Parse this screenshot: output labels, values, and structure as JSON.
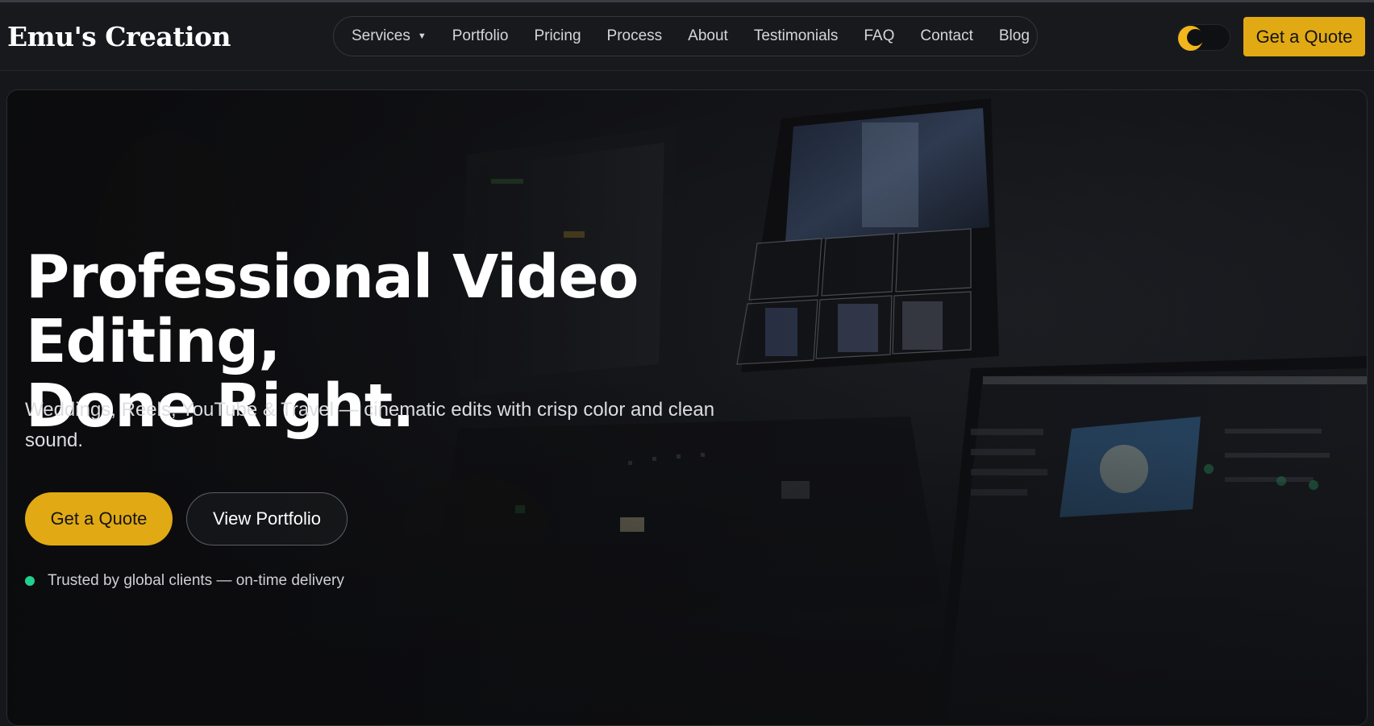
{
  "brand": {
    "name": "Emu's Creation"
  },
  "nav": {
    "items": [
      {
        "label": "Services",
        "has_dropdown": true
      },
      {
        "label": "Portfolio"
      },
      {
        "label": "Pricing"
      },
      {
        "label": "Process"
      },
      {
        "label": "About"
      },
      {
        "label": "Testimonials"
      },
      {
        "label": "FAQ"
      },
      {
        "label": "Contact"
      },
      {
        "label": "Blog"
      }
    ]
  },
  "header": {
    "cta_label": "Get a Quote",
    "theme_toggle_icon": "moon-icon"
  },
  "hero": {
    "headline_line1": "Professional Video Editing,",
    "headline_line2": "Done Right.",
    "subheadline": "Weddings, Reels, YouTube & Travel — cinematic edits with crisp color and clean sound.",
    "primary_cta": "Get a Quote",
    "secondary_cta": "View Portfolio",
    "trust_text": "Trusted by global clients — on-time delivery"
  },
  "colors": {
    "accent": "#e1a914",
    "status_dot": "#21d08e",
    "background": "#15171b"
  }
}
